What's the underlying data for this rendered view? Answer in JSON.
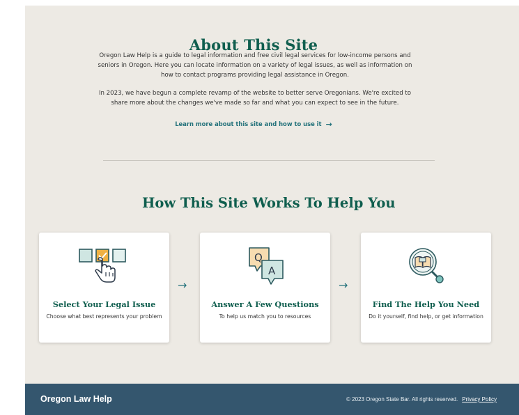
{
  "about": {
    "title": "About This Site",
    "paragraph1": "Oregon Law Help is a guide to legal information and free civil legal services for low-income persons and seniors in Oregon. Here you can locate information on a variety of legal issues, as well as information on how to contact programs providing legal assistance in Oregon.",
    "paragraph2": "In 2023, we have begun a complete revamp of the website to better serve Oregonians. We're excited to share more about the changes we've made so far and what you can expect to see in the future.",
    "link_label": "Learn more about this site and how to use it",
    "link_arrow": "→"
  },
  "how": {
    "title": "How This Site Works To Help You",
    "arrow": "→",
    "steps": [
      {
        "title": "Select Your Legal Issue",
        "description": "Choose what best represents your problem",
        "icon": "select-boxes-pointer-icon"
      },
      {
        "title": "Answer A Few Questions",
        "description": "To help us match you to resources",
        "icon": "question-answer-bubbles-icon",
        "q_letter": "Q",
        "a_letter": "A"
      },
      {
        "title": "Find The Help You Need",
        "description": "Do it yourself, find help, or get information",
        "icon": "book-magnifier-icon"
      }
    ]
  },
  "footer": {
    "brand": "Oregon Law Help",
    "copyright": "© 2023 Oregon State Bar. All rights  reserved.",
    "privacy_link": "Privacy Policy"
  },
  "colors": {
    "page_background": "#edeae4",
    "heading_green": "#0f5e4e",
    "link_teal": "#22717a",
    "footer_navy": "#34566e",
    "icon_mint": "#cfe6e2",
    "icon_amber": "#f0b144",
    "icon_peach": "#f7dcb0"
  }
}
